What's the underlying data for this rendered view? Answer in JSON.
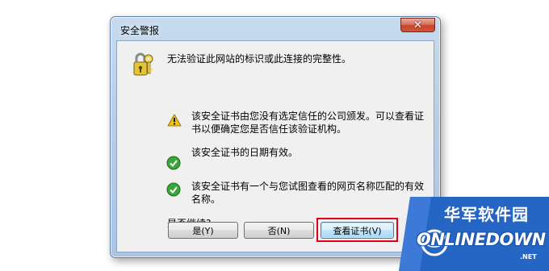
{
  "window": {
    "title": "安全警报",
    "close_glyph": "✕"
  },
  "message": {
    "main": "无法验证此网站的标识或此连接的完整性。",
    "warning": "该安全证书由您没有选定信任的公司颁发。可以查看证书以便确定您是否信任该验证机构。",
    "date_ok": "该安全证书的日期有效。",
    "name_ok": "该安全证书有一个与您试图查看的网页名称匹配的有效名称。",
    "prompt": "是否继续?"
  },
  "buttons": {
    "yes": "是(Y)",
    "no": "否(N)",
    "view_cert": "查看证书(V)"
  },
  "icons": {
    "header": "lock-key-icon",
    "warning": "warning-icon",
    "ok": "check-icon"
  },
  "watermark": {
    "cn": "华军软件园",
    "en": "ONLINEDOWN",
    "suffix": ".NET"
  },
  "colors": {
    "highlight": "#e0001a",
    "title_bar": "#b9cfe7",
    "check_green": "#2e9a2e",
    "warning_yellow": "#f2c10f"
  }
}
